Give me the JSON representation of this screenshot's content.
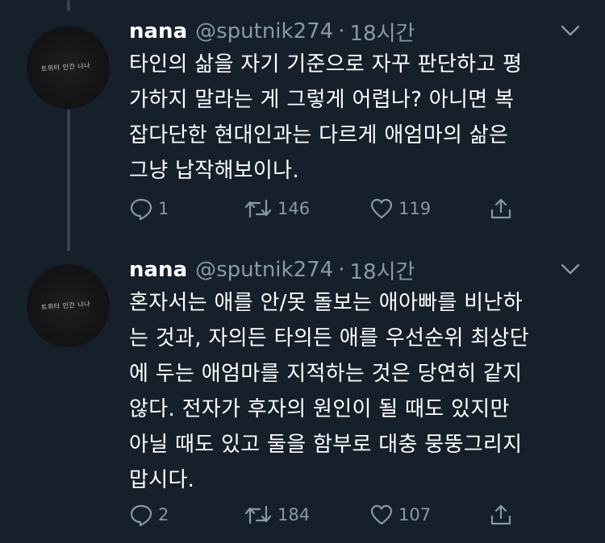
{
  "tweets": [
    {
      "name": "nana",
      "handle": "@sputnik274",
      "dot": "·",
      "time": "18시간",
      "avatar_text": "트위터 인간 나나",
      "text": "타인의 삶을 자기 기준으로 자꾸 판단하고 평\n가하지 말라는 게 그렇게 어렵나? 아니면 복\n잡다단한 현대인과는 다르게 애엄마의 삶은\n그냥 납작해보이나.",
      "replies": "1",
      "retweets": "146",
      "likes": "119"
    },
    {
      "name": "nana",
      "handle": "@sputnik274",
      "dot": "·",
      "time": "18시간",
      "avatar_text": "트위터 인간 나나",
      "text": "혼자서는 애를 안/못 돌보는 애아빠를 비난하\n는 것과, 자의든 타의든 애를 우선순위 최상단\n에 두는 애엄마를 지적하는 것은 당연히 같지\n않다. 전자가 후자의 원인이 될 때도 있지만\n아닐 때도 있고 둘을 함부로 대충 뭉뚱그리지\n맙시다.",
      "replies": "2",
      "retweets": "184",
      "likes": "107"
    }
  ],
  "colors": {
    "background": "#15202b",
    "secondary_text": "#8899a6",
    "thread_line": "#38444d"
  },
  "icons": [
    "reply-icon",
    "retweet-icon",
    "like-icon",
    "share-icon",
    "chevron-down-icon"
  ]
}
